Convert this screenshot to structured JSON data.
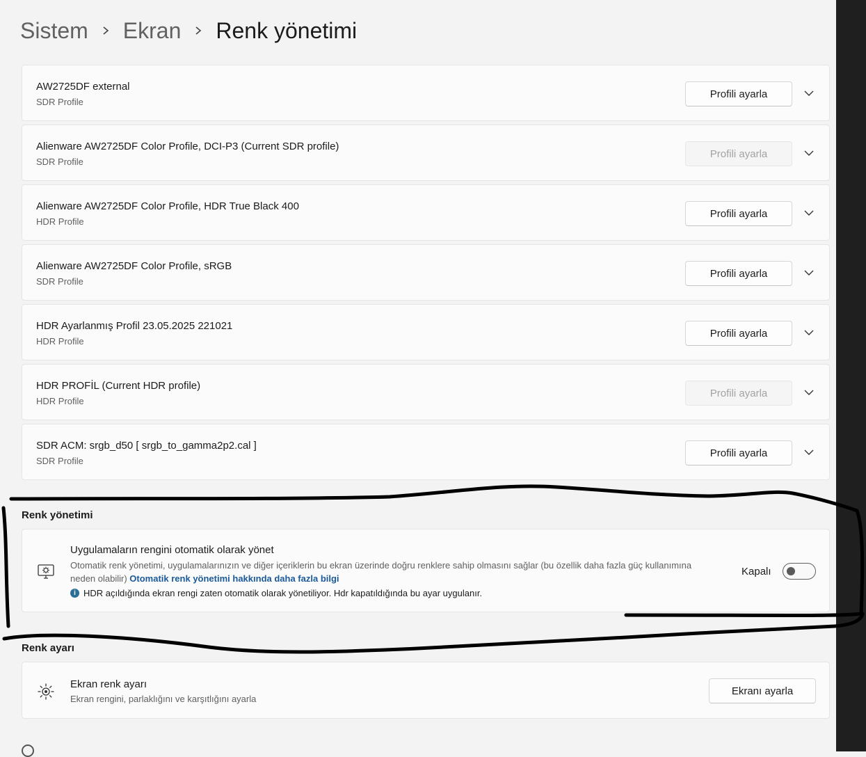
{
  "breadcrumb": {
    "items": [
      "Sistem",
      "Ekran"
    ],
    "current": "Renk yönetimi"
  },
  "profiles": [
    {
      "name": "AW2725DF external",
      "type": "SDR Profile",
      "button": "Profili ayarla",
      "button_enabled": true
    },
    {
      "name": "Alienware AW2725DF Color Profile, DCI-P3 (Current SDR profile)",
      "type": "SDR Profile",
      "button": "Profili ayarla",
      "button_enabled": false
    },
    {
      "name": "Alienware AW2725DF Color Profile, HDR True Black 400",
      "type": "HDR Profile",
      "button": "Profili ayarla",
      "button_enabled": true
    },
    {
      "name": "Alienware AW2725DF Color Profile, sRGB",
      "type": "SDR Profile",
      "button": "Profili ayarla",
      "button_enabled": true
    },
    {
      "name": "HDR Ayarlanmış Profil 23.05.2025 221021",
      "type": "HDR Profile",
      "button": "Profili ayarla",
      "button_enabled": true
    },
    {
      "name": "HDR PROFİL  (Current HDR profile)",
      "type": "HDR Profile",
      "button": "Profili ayarla",
      "button_enabled": false
    },
    {
      "name": "SDR ACM: srgb_d50 [ srgb_to_gamma2p2.cal ]",
      "type": "SDR Profile",
      "button": "Profili ayarla",
      "button_enabled": true
    }
  ],
  "color_management": {
    "section_label": "Renk yönetimi",
    "icon": "monitor-color-icon",
    "title": "Uygulamaların rengini otomatik olarak yönet",
    "description": "Otomatik renk yönetimi, uygulamalarınızın ve diğer içeriklerin bu ekran üzerinde doğru renklere sahip olmasını sağlar (bu özellik daha fazla güç kullanımına neden olabilir)",
    "link": "Otomatik renk yönetimi hakkında daha fazla bilgi",
    "note": "HDR açıldığında ekran rengi zaten otomatik olarak yönetiliyor. Hdr kapatıldığında bu ayar uygulanır.",
    "toggle_label": "Kapalı",
    "toggle_on": false
  },
  "color_calibration": {
    "section_label": "Renk ayarı",
    "icon": "brightness-sun-icon",
    "title": "Ekran renk ayarı",
    "subtitle": "Ekran rengini, parlaklığını ve karşıtlığını ayarla",
    "button": "Ekranı ayarla"
  },
  "colors": {
    "page_bg": "#f3f3f3",
    "card_bg": "#fbfbfb",
    "link": "#1a5a9a",
    "info": "#2b6e96",
    "marker": "#000000"
  }
}
